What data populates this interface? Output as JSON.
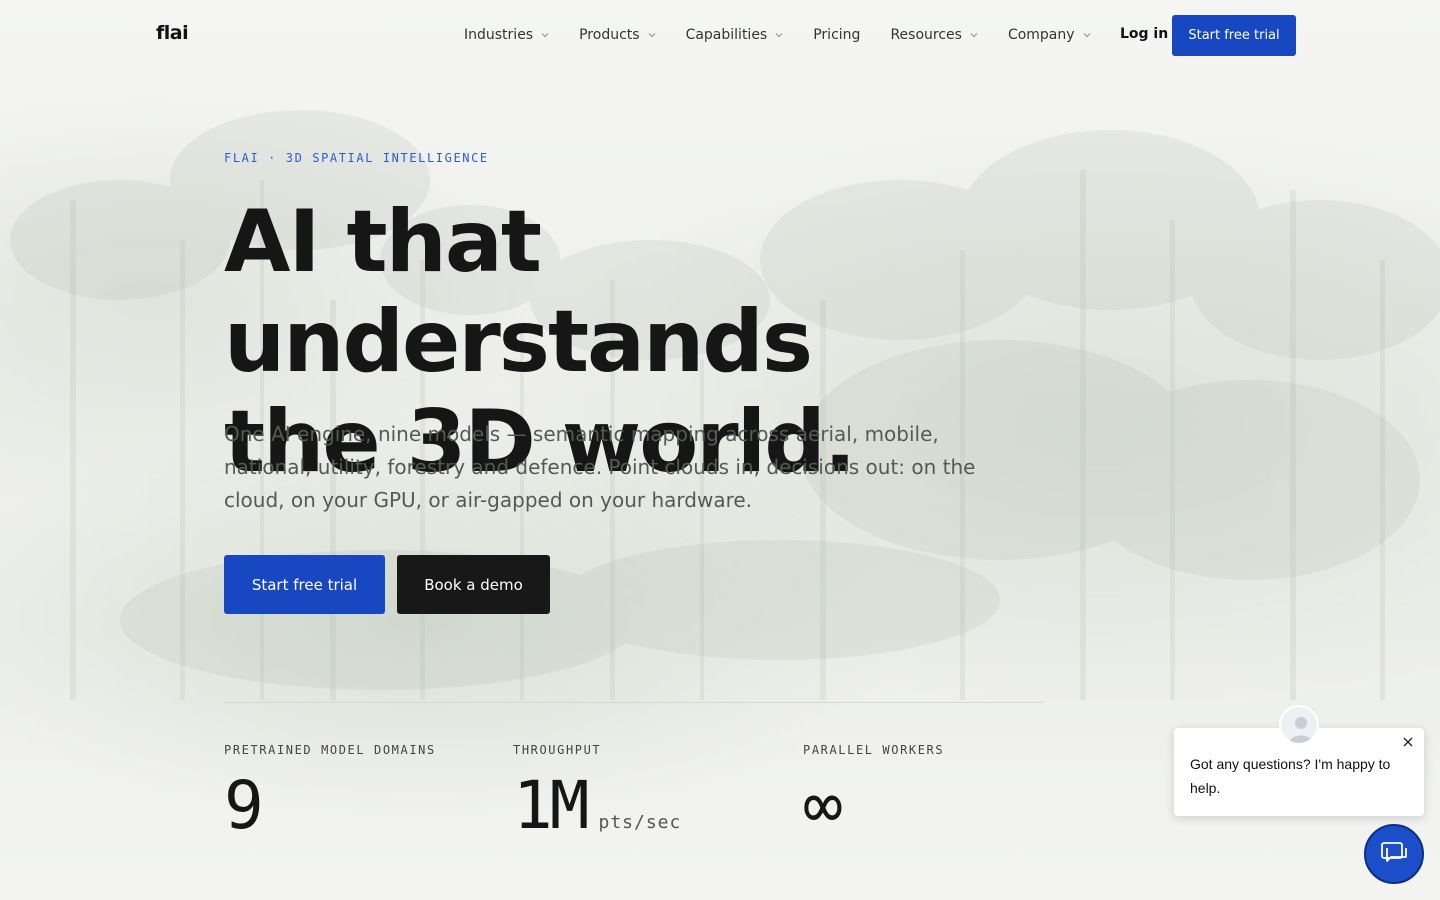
{
  "nav": {
    "logo": "flai",
    "items": [
      {
        "label": "Industries",
        "has_dropdown": true
      },
      {
        "label": "Products",
        "has_dropdown": true
      },
      {
        "label": "Capabilities",
        "has_dropdown": true
      },
      {
        "label": "Pricing",
        "has_dropdown": false
      },
      {
        "label": "Resources",
        "has_dropdown": true
      },
      {
        "label": "Company",
        "has_dropdown": true
      }
    ],
    "login_label": "Log in",
    "trial_label": "Start free trial"
  },
  "hero": {
    "eyebrow": "FLAI · 3D SPATIAL INTELLIGENCE",
    "headline_line1": "AI that understands",
    "headline_line2": "the 3D world.",
    "subhead": "One AI engine, nine models — semantic mapping across aerial, mobile, national, utility, forestry and defence. Point clouds in, decisions out: on the cloud, on your GPU, or air-gapped on your hardware.",
    "primary_cta": "Start free trial",
    "secondary_cta": "Book a demo"
  },
  "stats": [
    {
      "label": "PRETRAINED MODEL DOMAINS",
      "value": "9",
      "unit": ""
    },
    {
      "label": "THROUGHPUT",
      "value": "1M",
      "unit": "pts/sec"
    },
    {
      "label": "PARALLEL WORKERS",
      "value": "∞",
      "unit": ""
    }
  ],
  "chat": {
    "message": "Got any questions? I'm happy to help.",
    "launcher_icon": "chat-icon",
    "close_icon": "close-icon"
  },
  "colors": {
    "accent": "#1847c2",
    "eyebrow": "#2f5bd0",
    "dark_button": "#181818",
    "text": "#161616"
  }
}
